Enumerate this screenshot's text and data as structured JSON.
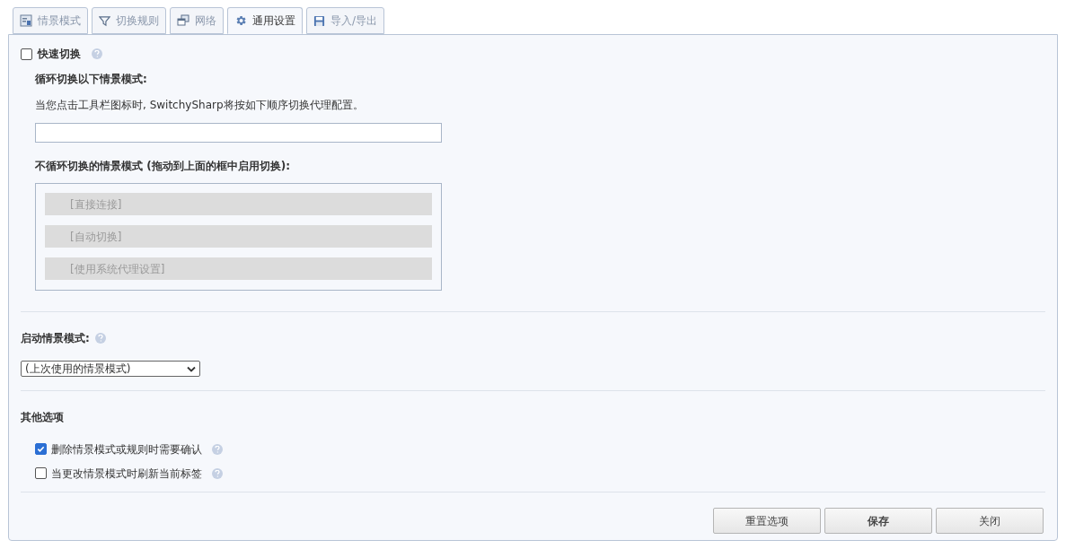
{
  "tabs": [
    {
      "label": "情景模式",
      "kind": "profile",
      "selected": false
    },
    {
      "label": "切换规则",
      "kind": "filter",
      "selected": false
    },
    {
      "label": "网络",
      "kind": "network",
      "selected": false
    },
    {
      "label": "通用设置",
      "kind": "gear",
      "selected": true
    },
    {
      "label": "导入/导出",
      "kind": "disk",
      "selected": false
    }
  ],
  "quick_switch": {
    "label": "快速切换",
    "checked": false,
    "cycle_heading": "循环切换以下情景模式:",
    "description": "当您点击工具栏图标时, SwitchySharp将按如下顺序切换代理配置。",
    "excluded_heading": "不循环切换的情景模式 (拖动到上面的框中启用切换):",
    "excluded_profiles": [
      "[直接连接]",
      "[自动切换]",
      "[使用系统代理设置]"
    ]
  },
  "startup": {
    "label": "启动情景模式:",
    "select_value": "(上次使用的情景模式)"
  },
  "other_options": {
    "heading": "其他选项",
    "options": [
      {
        "label": "删除情景模式或规则时需要确认",
        "checked": true
      },
      {
        "label": "当更改情景模式时刷新当前标签",
        "checked": false
      }
    ]
  },
  "buttons": [
    {
      "label": "重置选项",
      "kind": "normal"
    },
    {
      "label": "保存",
      "kind": "primary"
    },
    {
      "label": "关闭",
      "kind": "normal"
    }
  ]
}
